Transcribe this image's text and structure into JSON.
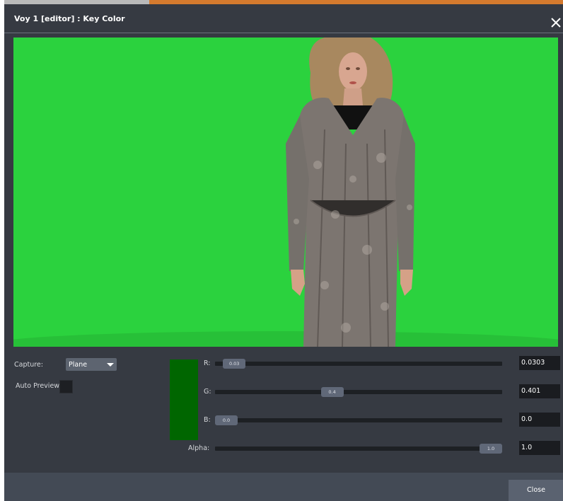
{
  "window": {
    "title": "Voy 1 [editor] : Key Color"
  },
  "capture": {
    "label": "Capture:",
    "value": "Plane"
  },
  "auto_preview": {
    "label": "Auto Preview:",
    "checked": false
  },
  "key_color_swatch": {
    "color": "#006600"
  },
  "sliders": {
    "r": {
      "label": "R:",
      "thumb": "0.03",
      "value": "0.0303",
      "fraction": 0.03
    },
    "g": {
      "label": "G:",
      "thumb": "0.4",
      "value": "0.401",
      "fraction": 0.4
    },
    "b": {
      "label": "B:",
      "thumb": "0.0",
      "value": "0.0",
      "fraction": 0.0
    },
    "alpha": {
      "label": "Alpha:",
      "thumb": "1.0",
      "value": "1.0",
      "fraction": 1.0
    }
  },
  "footer": {
    "close_label": "Close"
  },
  "colors": {
    "panel": "#363a42",
    "accent": "#d57a2e",
    "green_screen": "#2bd23e"
  },
  "icons": {
    "close": "close-icon",
    "dropdown": "chevron-down-icon"
  }
}
